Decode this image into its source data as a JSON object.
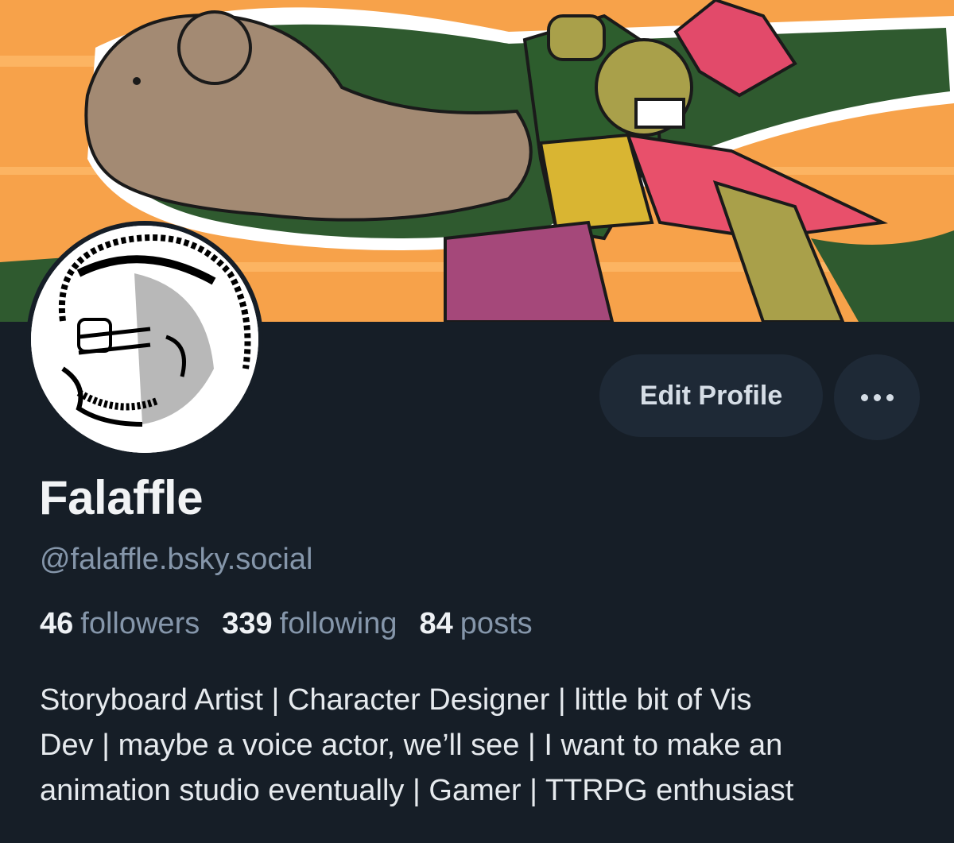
{
  "profile": {
    "display_name": "Falaffle",
    "handle": "@falaffle.bsky.social",
    "bio_lines": [
      "Storyboard Artist | Character Designer | little bit of Vis",
      "Dev | maybe a voice actor, we’ll see | I want to make an",
      "animation studio eventually | Gamer | TTRPG enthusiast"
    ]
  },
  "stats": {
    "followers_count": "46",
    "followers_label": "followers",
    "following_count": "339",
    "following_label": "following",
    "posts_count": "84",
    "posts_label": "posts"
  },
  "actions": {
    "edit_profile_label": "Edit Profile",
    "more_icon": "ellipsis-icon"
  },
  "colors": {
    "background": "#161e27",
    "button_bg": "#1e2936",
    "muted_text": "#8596aa",
    "banner_orange": "#f7a24a"
  }
}
